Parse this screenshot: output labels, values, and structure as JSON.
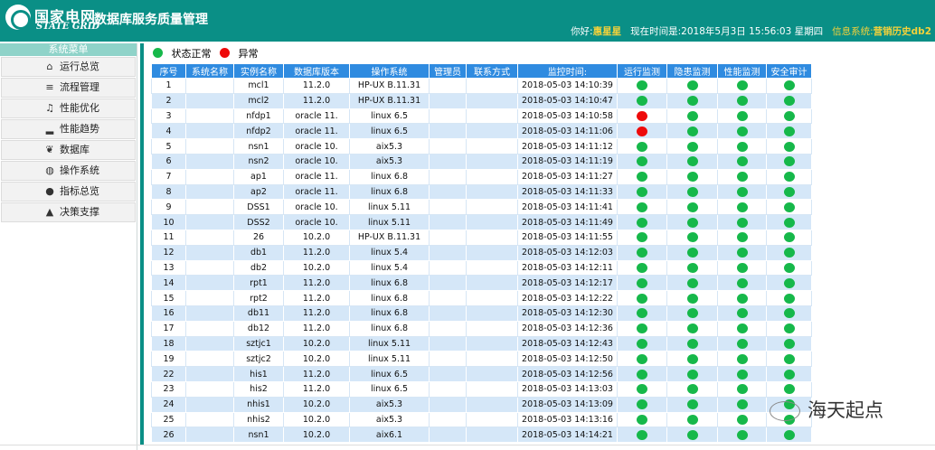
{
  "header": {
    "brand_cn": "国家电网",
    "brand_en": "STATE GRID",
    "title": "数据库服务质量管理",
    "greeting": "你好:",
    "user": "惠星星",
    "time_label": "现在时间是:",
    "time_value": "2018年5月3日 15:56:03 星期四",
    "system_label": "信息系统:",
    "system_value": "营销历史db2"
  },
  "sidebar": {
    "title": "系统菜单",
    "items": [
      {
        "label": "运行总览",
        "icon": "home-icon",
        "glyph": "⌂"
      },
      {
        "label": "流程管理",
        "icon": "list-icon",
        "glyph": "≡"
      },
      {
        "label": "性能优化",
        "icon": "music-note-icon",
        "glyph": "♫"
      },
      {
        "label": "性能趋势",
        "icon": "bar-signal-icon",
        "glyph": "▂"
      },
      {
        "label": "数据库",
        "icon": "leaf-icon",
        "glyph": "❦"
      },
      {
        "label": "操作系统",
        "icon": "globe-icon",
        "glyph": "◍"
      },
      {
        "label": "指标总览",
        "icon": "apple-icon",
        "glyph": "●"
      },
      {
        "label": "决策支撑",
        "icon": "graduation-cap-icon",
        "glyph": "▲"
      }
    ]
  },
  "legend": {
    "normal": "状态正常",
    "abnormal": "异常"
  },
  "colors": {
    "normal": "#16b84a",
    "abnormal": "#ee0a0a",
    "header": "#0a8f86",
    "table_head": "#2f8be0"
  },
  "table": {
    "headers": [
      "序号",
      "系统名称",
      "实例名称",
      "数据库版本",
      "操作系统",
      "管理员",
      "联系方式",
      "监控时间:",
      "运行监测",
      "隐患监测",
      "性能监测",
      "安全审计"
    ],
    "rows": [
      [
        "1",
        "",
        "mcl1",
        "11.2.0",
        "HP-UX B.11.31",
        "",
        "",
        "2018-05-03 14:10:39",
        "g",
        "g",
        "g",
        "g"
      ],
      [
        "2",
        "",
        "mcl2",
        "11.2.0",
        "HP-UX B.11.31",
        "",
        "",
        "2018-05-03 14:10:47",
        "g",
        "g",
        "g",
        "g"
      ],
      [
        "3",
        "",
        "nfdp1",
        "oracle 11.",
        "linux 6.5",
        "",
        "",
        "2018-05-03 14:10:58",
        "r",
        "g",
        "g",
        "g"
      ],
      [
        "4",
        "",
        "nfdp2",
        "oracle 11.",
        "linux 6.5",
        "",
        "",
        "2018-05-03 14:11:06",
        "r",
        "g",
        "g",
        "g"
      ],
      [
        "5",
        "",
        "nsn1",
        "oracle 10.",
        "aix5.3",
        "",
        "",
        "2018-05-03 14:11:12",
        "g",
        "g",
        "g",
        "g"
      ],
      [
        "6",
        "",
        "nsn2",
        "oracle 10.",
        "aix5.3",
        "",
        "",
        "2018-05-03 14:11:19",
        "g",
        "g",
        "g",
        "g"
      ],
      [
        "7",
        "",
        "ap1",
        "oracle 11.",
        "linux 6.8",
        "",
        "",
        "2018-05-03 14:11:27",
        "g",
        "g",
        "g",
        "g"
      ],
      [
        "8",
        "",
        "ap2",
        "oracle 11.",
        "linux 6.8",
        "",
        "",
        "2018-05-03 14:11:33",
        "g",
        "g",
        "g",
        "g"
      ],
      [
        "9",
        "",
        "DSS1",
        "oracle 10.",
        "linux 5.11",
        "",
        "",
        "2018-05-03 14:11:41",
        "g",
        "g",
        "g",
        "g"
      ],
      [
        "10",
        "",
        "DSS2",
        "oracle 10.",
        "linux 5.11",
        "",
        "",
        "2018-05-03 14:11:49",
        "g",
        "g",
        "g",
        "g"
      ],
      [
        "11",
        "",
        "26",
        "10.2.0",
        "HP-UX B.11.31",
        "",
        "",
        "2018-05-03 14:11:55",
        "g",
        "g",
        "g",
        "g"
      ],
      [
        "12",
        "",
        "db1",
        "11.2.0",
        "linux 5.4",
        "",
        "",
        "2018-05-03 14:12:03",
        "g",
        "g",
        "g",
        "g"
      ],
      [
        "13",
        "",
        "db2",
        "10.2.0",
        "linux 5.4",
        "",
        "",
        "2018-05-03 14:12:11",
        "g",
        "g",
        "g",
        "g"
      ],
      [
        "14",
        "",
        "rpt1",
        "11.2.0",
        "linux 6.8",
        "",
        "",
        "2018-05-03 14:12:17",
        "g",
        "g",
        "g",
        "g"
      ],
      [
        "15",
        "",
        "rpt2",
        "11.2.0",
        "linux 6.8",
        "",
        "",
        "2018-05-03 14:12:22",
        "g",
        "g",
        "g",
        "g"
      ],
      [
        "16",
        "",
        "db11",
        "11.2.0",
        "linux 6.8",
        "",
        "",
        "2018-05-03 14:12:30",
        "g",
        "g",
        "g",
        "g"
      ],
      [
        "17",
        "",
        "db12",
        "11.2.0",
        "linux 6.8",
        "",
        "",
        "2018-05-03 14:12:36",
        "g",
        "g",
        "g",
        "g"
      ],
      [
        "18",
        "",
        "sztjc1",
        "10.2.0",
        "linux 5.11",
        "",
        "",
        "2018-05-03 14:12:43",
        "g",
        "g",
        "g",
        "g"
      ],
      [
        "19",
        "",
        "sztjc2",
        "10.2.0",
        "linux 5.11",
        "",
        "",
        "2018-05-03 14:12:50",
        "g",
        "g",
        "g",
        "g"
      ],
      [
        "22",
        "",
        "his1",
        "11.2.0",
        "linux 6.5",
        "",
        "",
        "2018-05-03 14:12:56",
        "g",
        "g",
        "g",
        "g"
      ],
      [
        "23",
        "",
        "his2",
        "11.2.0",
        "linux 6.5",
        "",
        "",
        "2018-05-03 14:13:03",
        "g",
        "g",
        "g",
        "g"
      ],
      [
        "24",
        "",
        "nhis1",
        "10.2.0",
        "aix5.3",
        "",
        "",
        "2018-05-03 14:13:09",
        "g",
        "g",
        "g",
        "g"
      ],
      [
        "25",
        "",
        "nhis2",
        "10.2.0",
        "aix5.3",
        "",
        "",
        "2018-05-03 14:13:16",
        "g",
        "g",
        "g",
        "g"
      ],
      [
        "26",
        "",
        "nsn1",
        "10.2.0",
        "aix6.1",
        "",
        "",
        "2018-05-03 14:14:21",
        "g",
        "g",
        "g",
        "g"
      ]
    ]
  },
  "watermark": {
    "text": "海天起点",
    "icon": "wechat-icon"
  }
}
